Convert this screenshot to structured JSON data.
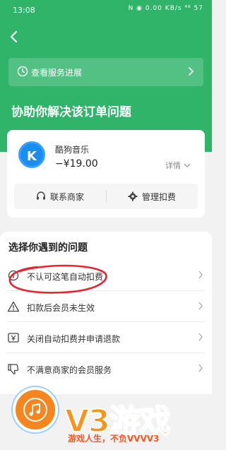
{
  "status_bar": {
    "time": "13:08",
    "indicators": "N ◉ 0.00 KB/s ⁴⁶ 57"
  },
  "header": {
    "back_icon": "back-arrow-icon",
    "service_progress": "查看服务进展",
    "heading": "协助你解决该订单问题"
  },
  "order": {
    "app_logo_letter": "K",
    "app_name": "酷狗音乐",
    "price": "−¥19.00",
    "detail_label": "详情",
    "actions": {
      "contact_label": "联系商家",
      "manage_label": "管理扣费"
    }
  },
  "problems": {
    "title": "选择你遇到的问题",
    "items": [
      {
        "label": "不认可这笔自动扣费",
        "icon": "info-icon"
      },
      {
        "label": "扣款后会员未生效",
        "icon": "warning-icon"
      },
      {
        "label": "关闭自动扣费并申请退款",
        "icon": "yuan-refund-icon"
      },
      {
        "label": "不满意商家的会员服务",
        "icon": "thumbs-down-icon"
      }
    ]
  },
  "watermark": {
    "brand": "V3游戏",
    "slogan": "游戏人生，不负VVVV3"
  },
  "colors": {
    "header_green": "#2fb46a",
    "annotation_red": "#e5252f",
    "watermark_orange": "#f7941d"
  }
}
